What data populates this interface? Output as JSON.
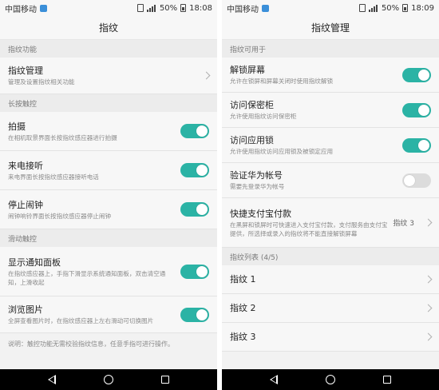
{
  "left": {
    "status": {
      "carrier": "中国移动",
      "battery": "50%",
      "time": "18:08"
    },
    "title": "指纹",
    "sections": {
      "fingerprint_func": {
        "header": "指纹功能",
        "manage": {
          "title": "指纹管理",
          "sub": "管理及设置指纹相关功能"
        }
      },
      "long_press": {
        "header": "长按触控",
        "items": [
          {
            "title": "拍摄",
            "sub": "在相机取景界面长按指纹感应器进行拍摄",
            "on": true
          },
          {
            "title": "来电接听",
            "sub": "来电界面长按指纹感应器接听电话",
            "on": true
          },
          {
            "title": "停止闹钟",
            "sub": "闹钟响铃界面长按指纹感应器停止闹钟",
            "on": true
          }
        ]
      },
      "swipe": {
        "header": "滑动触控",
        "items": [
          {
            "title": "显示通知面板",
            "sub": "在指纹感应器上，手指下滑显示系统通知面板，双击清空通知，上滑收起",
            "on": true
          },
          {
            "title": "浏览图片",
            "sub": "全屏查看图片时，在指纹感应器上左右滑动可切换图片",
            "on": true
          }
        ]
      }
    },
    "note": "说明：触控功能无需校验指纹信息，任意手指可进行操作。"
  },
  "right": {
    "status": {
      "carrier": "中国移动",
      "battery": "50%",
      "time": "18:09"
    },
    "title": "指纹管理",
    "usable_header": "指纹可用于",
    "items": [
      {
        "title": "解锁屏幕",
        "sub": "允许在锁屏和屏幕关闭时使用指纹解锁",
        "on": true
      },
      {
        "title": "访问保密柜",
        "sub": "允许使用指纹访问保密柜",
        "on": true
      },
      {
        "title": "访问应用锁",
        "sub": "允许使用指纹访问应用锁及被锁定应用",
        "on": true
      },
      {
        "title": "验证华为帐号",
        "sub": "需要先登录华为帐号",
        "on": false
      }
    ],
    "alipay": {
      "title": "快捷支付宝付款",
      "sub": "在黑屏和锁屏时可快速进入支付宝付款，支付服务由支付宝提供，所选择或录入的指纹将不能直接解锁屏幕",
      "value": "指纹 3"
    },
    "list_header": "指纹列表 (4/5)",
    "fingerprints": [
      "指纹 1",
      "指纹 2",
      "指纹 3"
    ]
  },
  "colors": {
    "accent": "#2bb3a5",
    "toggle_off": "#dcdcdc",
    "section_bg": "#ececec"
  }
}
